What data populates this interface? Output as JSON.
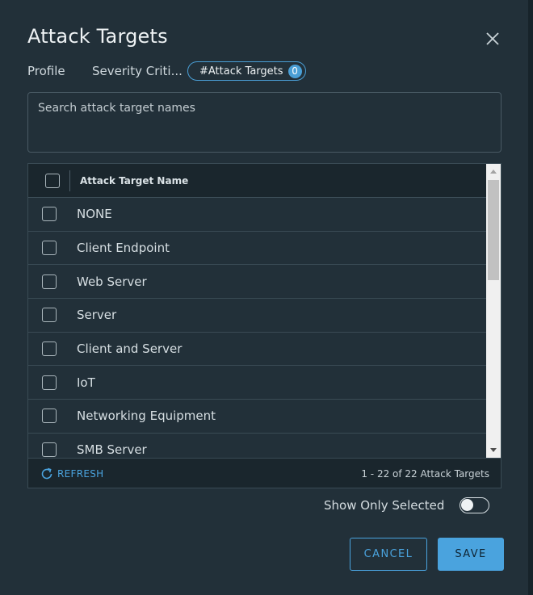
{
  "dialog": {
    "title": "Attack Targets",
    "close_label": "close"
  },
  "tabs": [
    {
      "label": "Profile"
    },
    {
      "label": "Severity Criti..."
    },
    {
      "label": "#Attack Targets",
      "badge": "0"
    }
  ],
  "search": {
    "placeholder": "Search attack target names",
    "value": ""
  },
  "grid": {
    "column_header": "Attack Target Name",
    "rows": [
      {
        "label": "NONE"
      },
      {
        "label": "Client Endpoint"
      },
      {
        "label": "Web Server"
      },
      {
        "label": "Server"
      },
      {
        "label": "Client and Server"
      },
      {
        "label": "IoT"
      },
      {
        "label": "Networking Equipment"
      },
      {
        "label": "SMB Server"
      }
    ],
    "refresh_label": "REFRESH",
    "count_text": "1 - 22 of 22 Attack Targets"
  },
  "toggle": {
    "label": "Show Only Selected",
    "checked": false
  },
  "buttons": {
    "cancel": "CANCEL",
    "save": "SAVE"
  },
  "colors": {
    "background": "#223039",
    "accent": "#4aa3de",
    "header_bg": "#1a262d"
  },
  "icons": {
    "close": "close-icon",
    "refresh": "refresh-icon",
    "scroll_up": "arrow-up-icon",
    "scroll_down": "arrow-down-icon"
  }
}
